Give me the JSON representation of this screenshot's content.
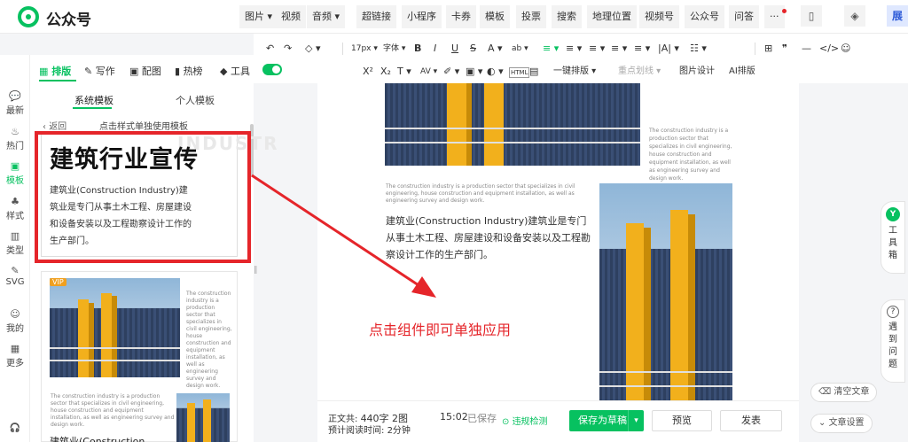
{
  "app": {
    "brand": "公众号"
  },
  "topbar": {
    "items": [
      {
        "label": "图片 ▾"
      },
      {
        "label": "视频"
      },
      {
        "label": "音频 ▾"
      },
      {
        "label": "超链接"
      },
      {
        "label": "小程序"
      },
      {
        "label": "卡券"
      },
      {
        "label": "模板"
      },
      {
        "label": "投票"
      },
      {
        "label": "搜索"
      },
      {
        "label": "地理位置"
      },
      {
        "label": "视频号"
      },
      {
        "label": "公众号"
      },
      {
        "label": "问答"
      },
      {
        "label": "···"
      }
    ],
    "icons": [
      "phone-icon",
      "shield-icon",
      "avatar-icon"
    ]
  },
  "panel_tabs": [
    {
      "label": "排版"
    },
    {
      "label": "写作"
    },
    {
      "label": "配图"
    },
    {
      "label": "热榜"
    },
    {
      "label": "工具"
    }
  ],
  "leftnav": [
    {
      "icon": "💬",
      "label": "最新"
    },
    {
      "icon": "♨",
      "label": "热门"
    },
    {
      "icon": "▣",
      "label": "模板"
    },
    {
      "icon": "♣",
      "label": "样式"
    },
    {
      "icon": "▥",
      "label": "类型"
    },
    {
      "icon": "✎",
      "label": "SVG"
    },
    {
      "icon": "☺",
      "label": "我的"
    },
    {
      "icon": "▦",
      "label": "更多"
    },
    {
      "icon": "🎧",
      "label": ""
    }
  ],
  "template_panel": {
    "subtabs": [
      {
        "label": "系统模板"
      },
      {
        "label": "个人模板"
      }
    ],
    "back": "返回",
    "hint": "点击样式单独使用模板",
    "card1": {
      "title": "建筑行业宣传",
      "bg_text": "INDUSTR",
      "body": "建筑业(Construction Industry)建筑业是专门从事土木工程、房屋建设和设备安装以及工程勘察设计工作的生产部门。"
    },
    "card2": {
      "vip": "VIP",
      "right_text": "The construction industry is a production sector that specializes in civil engineering, house construction and equipment installation, as well as engineering survey and design work.",
      "left_text": "The construction industry is a production sector that specializes in civil engineering, house construction and equipment installation, as well as engineering survey and design work.",
      "bottom_title": "建筑业(Construction"
    }
  },
  "format_toolbar": {
    "row1": [
      {
        "label": "↶"
      },
      {
        "label": "↷"
      },
      {
        "label": "◇ ▾"
      },
      {
        "label": "17px ▾"
      },
      {
        "label": "字体 ▾"
      },
      {
        "label": "B"
      },
      {
        "label": "I"
      },
      {
        "label": "U"
      },
      {
        "label": "S"
      },
      {
        "label": "A ▾"
      },
      {
        "label": "ab ▾"
      },
      {
        "label": "≡ ▾"
      },
      {
        "label": "≡ ▾"
      },
      {
        "label": "≡ ▾"
      },
      {
        "label": "≡ ▾"
      },
      {
        "label": "≡ ▾"
      },
      {
        "label": "|A| ▾"
      },
      {
        "label": "☷ ▾"
      },
      {
        "label": "⊞"
      },
      {
        "label": "❞"
      },
      {
        "label": "—"
      },
      {
        "label": "</>"
      },
      {
        "label": "☺"
      }
    ],
    "row2": [
      {
        "label": "X²"
      },
      {
        "label": "X₂"
      },
      {
        "label": "T ▾"
      },
      {
        "label": "AV ▾"
      },
      {
        "label": "✐ ▾"
      },
      {
        "label": "▣ ▾"
      },
      {
        "label": "◐ ▾"
      },
      {
        "label": "HTML"
      },
      {
        "label": "▤"
      },
      {
        "label": "一键排版 ▾"
      },
      {
        "label": "重点划线 ▾"
      },
      {
        "label": "图片设计"
      },
      {
        "label": "AI排版"
      }
    ]
  },
  "article": {
    "caption_top": "The construction industry is a production sector that specializes in civil engineering, house construction and equipment installation, as well as engineering survey and design work.",
    "caption_mid": "The construction industry is a production sector that specializes in civil engineering, house construction and equipment installation, as well as engineering survey and design work.",
    "body": "建筑业(Construction Industry)建筑业是专门从事土木工程、房屋建设和设备安装以及工程勘察设计工作的生产部门。"
  },
  "annotation": "点击组件即可单独应用",
  "bottombar": {
    "word_count_label": "正文共:",
    "word_count": "440字 2图",
    "read_time_label": "预计阅读时间:",
    "read_time": "2分钟",
    "time": "15:02",
    "saved": "已保存",
    "violation": "违规检测",
    "save_draft": "保存为草稿",
    "preview": "预览",
    "publish": "发表"
  },
  "right_rail": {
    "toolbox": "工具箱",
    "help": "遇到问题",
    "clear": "清空文章",
    "settings": "文章设置"
  },
  "colors": {
    "accent": "#07c160",
    "annotation_red": "#e5252a"
  }
}
